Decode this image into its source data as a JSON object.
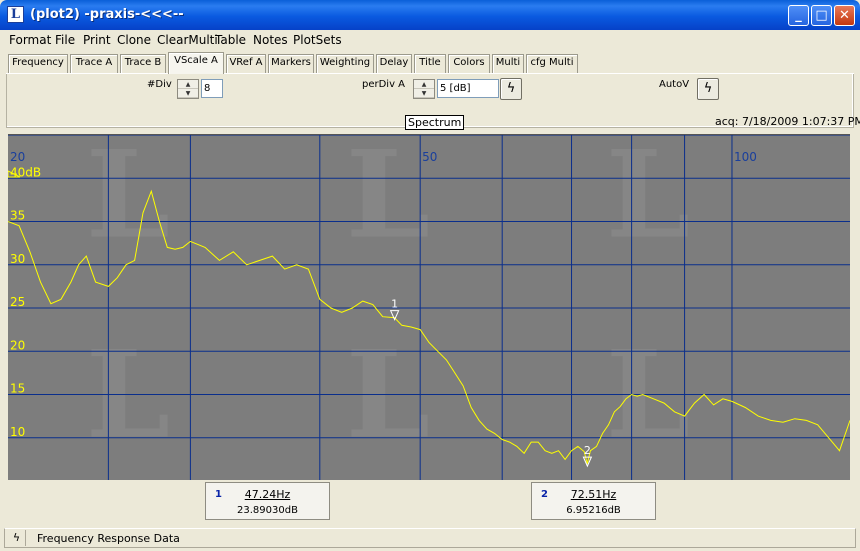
{
  "window": {
    "icon_letter": "L",
    "title": "(plot2) -praxis-<<<--",
    "minimize": "_",
    "maximize": "□",
    "close": "✕"
  },
  "menu": [
    "Format",
    "File",
    "Print",
    "Clone",
    "ClearMulti",
    "Table",
    "Notes",
    "PlotSets"
  ],
  "tabs": [
    "Frequency",
    "Trace A",
    "Trace B",
    "VScale A",
    "VRef A",
    "Markers",
    "Weighting",
    "Delay",
    "Title",
    "Colors",
    "Multi",
    "cfg Multi"
  ],
  "active_tab": "VScale A",
  "controls": {
    "div_label": "#Div",
    "div_value": "8",
    "perdiv_label": "perDiv A",
    "perdiv_value": "5 [dB]",
    "autov_label": "AutoV"
  },
  "plot": {
    "title": "Spectrum",
    "acq": "acq: 7/18/2009 1:07:37 PM",
    "colors": {
      "background": "#7d7d7d",
      "grid": "#0a2e8c",
      "trace": "#ffff00",
      "tick_x": "#1a3f9c"
    }
  },
  "chart_data": {
    "type": "line",
    "x_scale": "log",
    "x_ticks": [
      "20",
      "50",
      "100"
    ],
    "y_ticks": [
      "40dB",
      "35",
      "30",
      "25",
      "20",
      "15",
      "10"
    ],
    "xlim": [
      20,
      130
    ],
    "ylim": [
      5,
      45
    ],
    "grid": true,
    "series": [
      {
        "x": [
          20,
          20.5,
          21,
          21.5,
          22,
          22.5,
          23,
          23.4,
          23.8,
          24.3,
          25,
          25.5,
          26,
          26.5,
          27,
          27.5,
          28,
          28.5,
          29,
          29.5,
          30,
          31,
          32,
          33,
          34,
          35,
          36,
          37,
          38,
          39,
          40,
          41,
          42,
          43,
          44,
          45,
          46,
          47,
          47.2,
          48,
          49,
          50,
          51,
          52,
          53,
          54,
          55,
          56,
          57,
          58,
          59,
          60,
          61,
          62,
          63,
          64,
          65,
          66,
          67,
          68,
          69,
          70,
          71,
          72,
          72.5,
          73,
          74,
          75,
          76,
          77,
          78,
          79,
          80,
          81,
          82,
          84,
          86,
          88,
          90,
          92,
          94,
          96,
          98,
          100,
          103,
          106,
          109,
          112,
          115,
          118,
          121,
          124,
          127,
          130
        ],
        "values": [
          35,
          34.5,
          31.5,
          28,
          25.5,
          26,
          28,
          30,
          31,
          28,
          27.5,
          28.5,
          30,
          30.5,
          36,
          38.5,
          35,
          32,
          31.8,
          32,
          32.7,
          32,
          30.5,
          31.5,
          30,
          30.5,
          31,
          29.5,
          30,
          29.5,
          26,
          25,
          24.5,
          25,
          25.8,
          25.4,
          24,
          23.9,
          23.9,
          23,
          22.8,
          22.5,
          21,
          20,
          19,
          17.5,
          16,
          13.5,
          12,
          11,
          10.5,
          9.8,
          9.5,
          9,
          8.2,
          9.5,
          9.5,
          8.5,
          8.2,
          8.5,
          7.5,
          8.5,
          9,
          8.4,
          7,
          8.5,
          9,
          10.5,
          11.5,
          13,
          13.6,
          14.5,
          15,
          14.8,
          15,
          14.5,
          14,
          13,
          12.5,
          14,
          15,
          13.8,
          14.5,
          14.2,
          13.5,
          12.5,
          12,
          11.8,
          12.2,
          12,
          11.5,
          10,
          8.5,
          12
        ]
      }
    ],
    "markers": [
      {
        "label": "1",
        "x": 47.24,
        "y": 23.89
      },
      {
        "label": "2",
        "x": 72.51,
        "y": 6.95
      }
    ]
  },
  "marker_readouts": [
    {
      "num": "1",
      "freq": "47.24Hz",
      "value": "23.89030dB"
    },
    {
      "num": "2",
      "freq": "72.51Hz",
      "value": "6.95216dB"
    }
  ],
  "status": {
    "text": "Frequency Response Data"
  }
}
